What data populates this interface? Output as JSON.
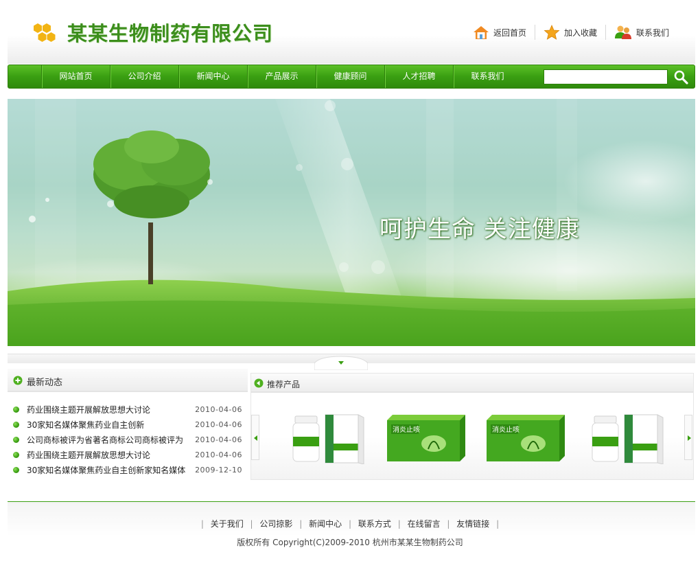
{
  "header": {
    "company_name": "某某生物制药有限公司",
    "links": [
      {
        "label": "返回首页",
        "icon": "home-icon"
      },
      {
        "label": "加入收藏",
        "icon": "star-icon"
      },
      {
        "label": "联系我们",
        "icon": "contact-icon"
      }
    ]
  },
  "nav": {
    "items": [
      "网站首页",
      "公司介绍",
      "新闻中心",
      "产品展示",
      "健康顾问",
      "人才招聘",
      "联系我们"
    ],
    "search_value": "",
    "search_placeholder": ""
  },
  "banner": {
    "slogan": "呵护生命 关注健康"
  },
  "news": {
    "title": "最新动态",
    "items": [
      {
        "title": "药业围绕主题开展解放思想大讨论",
        "date": "2010-04-06"
      },
      {
        "title": "30家知名媒体聚焦药业自主创新",
        "date": "2010-04-06"
      },
      {
        "title": "公司商标被评为省著名商标公司商标被评为",
        "date": "2010-04-06"
      },
      {
        "title": "药业围绕主题开展解放思想大讨论",
        "date": "2010-04-06"
      },
      {
        "title": "30家知名媒体聚焦药业自主创新家知名媒体",
        "date": "2009-12-10"
      }
    ]
  },
  "products": {
    "title": "推荐产品",
    "items": [
      {
        "type": "bottle-box"
      },
      {
        "type": "green-box",
        "label": "消炎止咳"
      },
      {
        "type": "green-box",
        "label": "消炎止咳"
      },
      {
        "type": "bottle-box"
      }
    ]
  },
  "footer": {
    "links": [
      "关于我们",
      "公司掠影",
      "新闻中心",
      "联系方式",
      "在线留言",
      "友情链接"
    ],
    "copyright": "版权所有  Copyright(C)2009-2010 杭州市某某生物制药公司"
  },
  "colors": {
    "brand_green": "#3a9f12",
    "title_green": "#3c8e1c"
  }
}
